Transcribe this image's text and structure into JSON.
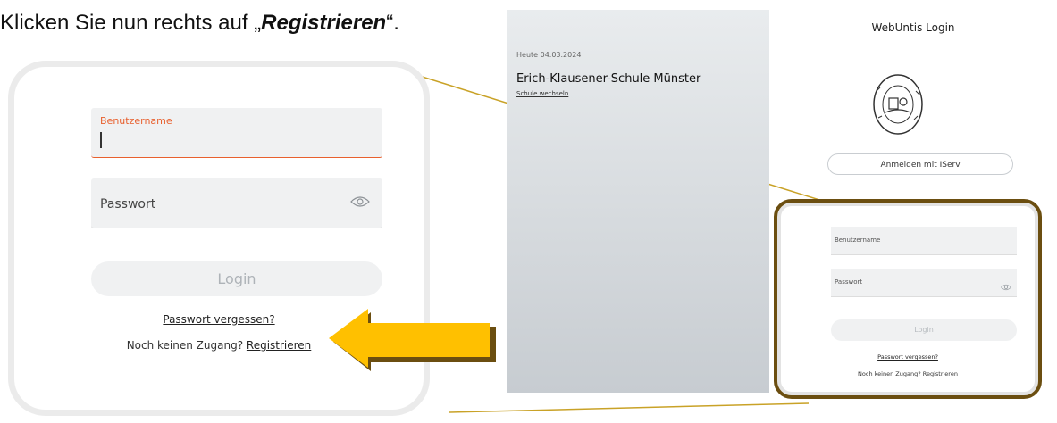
{
  "instruction": {
    "prefix": "Klicken Sie nun rechts auf „",
    "bold": "Registrieren",
    "suffix": "“."
  },
  "zoom": {
    "username_label": "Benutzername",
    "password_label": "Passwort",
    "login_label": "Login",
    "forgot_label": "Passwort vergessen?",
    "no_access_text": "Noch keinen Zugang?",
    "register_label": "Registrieren"
  },
  "school_panel": {
    "date": "Heute 04.03.2024",
    "school_name": "Erich-Klausener-Schule Münster",
    "switch_label": "Schule wechseln"
  },
  "login_screen": {
    "title": "WebUntis Login",
    "iserv_label": "Anmelden mit IServ",
    "username_placeholder": "Benutzername",
    "password_placeholder": "Passwort",
    "login_label": "Login",
    "forgot_label": "Passwort vergessen?",
    "no_access_text": "Noch keinen Zugang?",
    "register_label": "Registrieren"
  },
  "colors": {
    "accent_orange": "#e8602e",
    "arrow_yellow": "#ffc000",
    "connector_gold": "#c9a227",
    "highlight_border": "#6b4e10"
  }
}
